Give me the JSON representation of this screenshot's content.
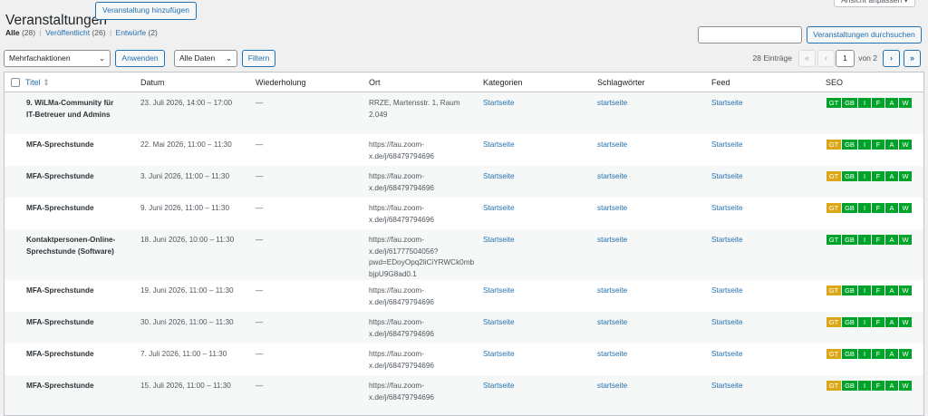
{
  "page": {
    "title": "Veranstaltungen",
    "add_button": "Veranstaltung hinzufügen",
    "screen_options": "Ansicht anpassen ▾"
  },
  "views": {
    "all_label": "Alle",
    "all_count": "(28)",
    "published_label": "Veröffentlicht",
    "published_count": "(26)",
    "drafts_label": "Entwürfe",
    "drafts_count": "(2)",
    "separator": "|"
  },
  "search": {
    "value": "",
    "button": "Veranstaltungen durchsuchen"
  },
  "filters": {
    "bulk_actions": "Mehrfachaktionen",
    "apply": "Anwenden",
    "dates": "Alle Daten",
    "filter": "Filtern",
    "chevron": "⌄"
  },
  "pagination": {
    "count": "28 Einträge",
    "first": "«",
    "prev": "‹",
    "next": "›",
    "last": "»",
    "current_page": "1",
    "of_total": "von 2"
  },
  "columns": {
    "title": "Titel",
    "sort_indicator": "⇕",
    "date": "Datum",
    "recurrence": "Wiederholung",
    "location": "Ort",
    "categories": "Kategorien",
    "tags": "Schlagwörter",
    "feed": "Feed",
    "seo": "SEO"
  },
  "seo_badges": [
    "GT",
    "GB",
    "I",
    "F",
    "A",
    "W"
  ],
  "colors": {
    "seo_ok": "#00a32a",
    "seo_warn": "#dba617",
    "link": "#2271b1"
  },
  "rows": [
    {
      "title": [
        "9. WiLMa-Community für",
        "IT-Betreuer und Admins"
      ],
      "date": "23. Juli 2026, 14:00 – 17:00",
      "recurrence": "—",
      "location": [
        "RRZE, Martensstr. 1, Raum",
        "2.049"
      ],
      "category": "Startseite",
      "tag": "startseite",
      "feed": "Startseite",
      "seo_gt_warn": false
    },
    {
      "title": [
        "MFA-Sprechstunde"
      ],
      "date": "22. Mai 2026, 11:00 – 11:30",
      "recurrence": "—",
      "location": [
        "https://fau.zoom-",
        "x.de/j/68479794696"
      ],
      "category": "Startseite",
      "tag": "startseite",
      "feed": "Startseite",
      "seo_gt_warn": true
    },
    {
      "title": [
        "MFA-Sprechstunde"
      ],
      "date": "3. Juni 2026, 11:00 – 11:30",
      "recurrence": "—",
      "location": [
        "https://fau.zoom-",
        "x.de/j/68479794696"
      ],
      "category": "Startseite",
      "tag": "startseite",
      "feed": "Startseite",
      "seo_gt_warn": true
    },
    {
      "title": [
        "MFA-Sprechstunde"
      ],
      "date": "9. Juni 2026, 11:00 – 11:30",
      "recurrence": "—",
      "location": [
        "https://fau.zoom-",
        "x.de/j/68479794696"
      ],
      "category": "Startseite",
      "tag": "startseite",
      "feed": "Startseite",
      "seo_gt_warn": true
    },
    {
      "title": [
        "Kontaktpersonen-Online-",
        "Sprechstunde (Software)"
      ],
      "date": "18. Juni 2026, 10:00 – 11:30",
      "recurrence": "—",
      "location": [
        "https://fau.zoom-",
        "x.de/j/61777504056?",
        "pwd=EDoyOpq2liCiYRWCk0mb",
        "bjpU9G8ad0.1"
      ],
      "category": "Startseite",
      "tag": "startseite",
      "feed": "Startseite",
      "seo_gt_warn": false
    },
    {
      "title": [
        "MFA-Sprechstunde"
      ],
      "date": "19. Juni 2026, 11:00 – 11:30",
      "recurrence": "—",
      "location": [
        "https://fau.zoom-",
        "x.de/j/68479794696"
      ],
      "category": "Startseite",
      "tag": "startseite",
      "feed": "Startseite",
      "seo_gt_warn": true
    },
    {
      "title": [
        "MFA-Sprechstunde"
      ],
      "date": "30. Juni 2026, 11:00 – 11:30",
      "recurrence": "—",
      "location": [
        "https://fau.zoom-",
        "x.de/j/68479794696"
      ],
      "category": "Startseite",
      "tag": "startseite",
      "feed": "Startseite",
      "seo_gt_warn": true
    },
    {
      "title": [
        "MFA-Sprechstunde"
      ],
      "date": "7. Juli 2026, 11:00 – 11:30",
      "recurrence": "—",
      "location": [
        "https://fau.zoom-",
        "x.de/j/68479794696"
      ],
      "category": "Startseite",
      "tag": "startseite",
      "feed": "Startseite",
      "seo_gt_warn": true
    },
    {
      "title": [
        "MFA-Sprechstunde"
      ],
      "date": "15. Juli 2026, 11:00 – 11:30",
      "recurrence": "—",
      "location": [
        "https://fau.zoom-",
        "x.de/j/68479794696"
      ],
      "category": "Startseite",
      "tag": "startseite",
      "feed": "Startseite",
      "seo_gt_warn": true
    }
  ]
}
